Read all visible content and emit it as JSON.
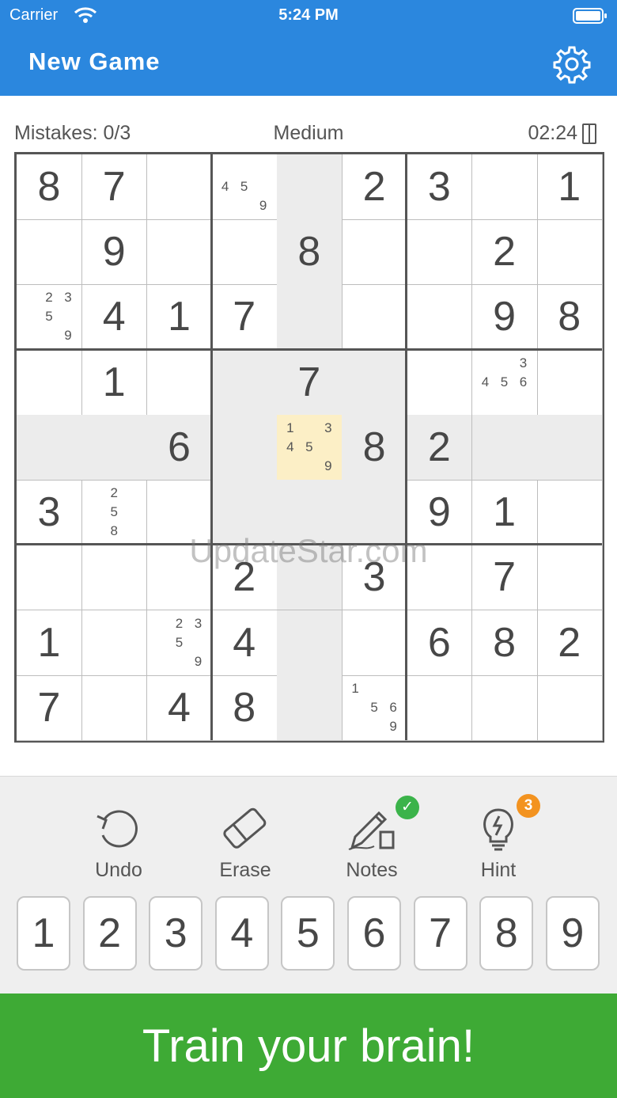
{
  "status_bar": {
    "carrier": "Carrier",
    "time": "5:24 PM"
  },
  "header": {
    "title": "New Game",
    "settings_icon": "gear-icon"
  },
  "info": {
    "mistakes": "Mistakes: 0/3",
    "difficulty": "Medium",
    "timer": "02:24",
    "pause_icon": "pause-icon"
  },
  "board": {
    "selected": [
      4,
      4
    ],
    "rows": [
      [
        {
          "v": "8"
        },
        {
          "v": "7"
        },
        {
          "v": ""
        },
        {
          "n": [
            "4",
            "5",
            "9"
          ]
        },
        {
          "v": ""
        },
        {
          "v": "2"
        },
        {
          "v": "3"
        },
        {
          "v": ""
        },
        {
          "v": "1"
        }
      ],
      [
        {
          "v": ""
        },
        {
          "v": "9"
        },
        {
          "v": ""
        },
        {
          "v": ""
        },
        {
          "v": "8"
        },
        {
          "v": ""
        },
        {
          "v": ""
        },
        {
          "v": "2"
        },
        {
          "v": ""
        }
      ],
      [
        {
          "n": [
            "2",
            "3",
            "5",
            "9"
          ]
        },
        {
          "v": "4"
        },
        {
          "v": "1"
        },
        {
          "v": "7"
        },
        {
          "v": ""
        },
        {
          "v": ""
        },
        {
          "v": ""
        },
        {
          "v": "9"
        },
        {
          "v": "8"
        }
      ],
      [
        {
          "v": ""
        },
        {
          "v": "1"
        },
        {
          "v": ""
        },
        {
          "v": ""
        },
        {
          "v": "7"
        },
        {
          "v": ""
        },
        {
          "v": ""
        },
        {
          "n": [
            "3",
            "4",
            "5",
            "6"
          ]
        },
        {
          "v": ""
        }
      ],
      [
        {
          "v": ""
        },
        {
          "v": ""
        },
        {
          "v": "6"
        },
        {
          "v": ""
        },
        {
          "n": [
            "1",
            "3",
            "4",
            "5",
            "9"
          ]
        },
        {
          "v": "8"
        },
        {
          "v": "2"
        },
        {
          "v": ""
        },
        {
          "v": ""
        }
      ],
      [
        {
          "v": "3"
        },
        {
          "n": [
            "2",
            "5",
            "8"
          ]
        },
        {
          "v": ""
        },
        {
          "v": ""
        },
        {
          "v": ""
        },
        {
          "v": ""
        },
        {
          "v": "9"
        },
        {
          "v": "1"
        },
        {
          "v": ""
        }
      ],
      [
        {
          "v": ""
        },
        {
          "v": ""
        },
        {
          "v": ""
        },
        {
          "v": "2"
        },
        {
          "v": ""
        },
        {
          "v": "3"
        },
        {
          "v": ""
        },
        {
          "v": "7"
        },
        {
          "v": ""
        }
      ],
      [
        {
          "v": "1"
        },
        {
          "v": ""
        },
        {
          "n": [
            "2",
            "3",
            "5",
            "9"
          ]
        },
        {
          "v": "4"
        },
        {
          "v": ""
        },
        {
          "v": ""
        },
        {
          "v": "6"
        },
        {
          "v": "8"
        },
        {
          "v": "2"
        }
      ],
      [
        {
          "v": "7"
        },
        {
          "v": ""
        },
        {
          "v": "4"
        },
        {
          "v": "8"
        },
        {
          "v": ""
        },
        {
          "n": [
            "1",
            "5",
            "6",
            "9"
          ]
        },
        {
          "v": ""
        },
        {
          "v": ""
        },
        {
          "v": ""
        }
      ]
    ]
  },
  "watermark": "UpdateStar.com",
  "tools": [
    {
      "label": "Undo",
      "icon": "undo-icon"
    },
    {
      "label": "Erase",
      "icon": "eraser-icon"
    },
    {
      "label": "Notes",
      "icon": "pencil-icon",
      "badge": "✓"
    },
    {
      "label": "Hint",
      "icon": "lightbulb-icon",
      "badge": "3"
    }
  ],
  "numpad": [
    "1",
    "2",
    "3",
    "4",
    "5",
    "6",
    "7",
    "8",
    "9"
  ],
  "banner": {
    "text": "Train your brain!"
  },
  "colors": {
    "header": "#2b87de",
    "selected_cell": "#fcefc6",
    "highlight": "#ececec",
    "banner": "#3eaa35",
    "check_badge": "#3bb34a",
    "hint_badge": "#f39320"
  }
}
